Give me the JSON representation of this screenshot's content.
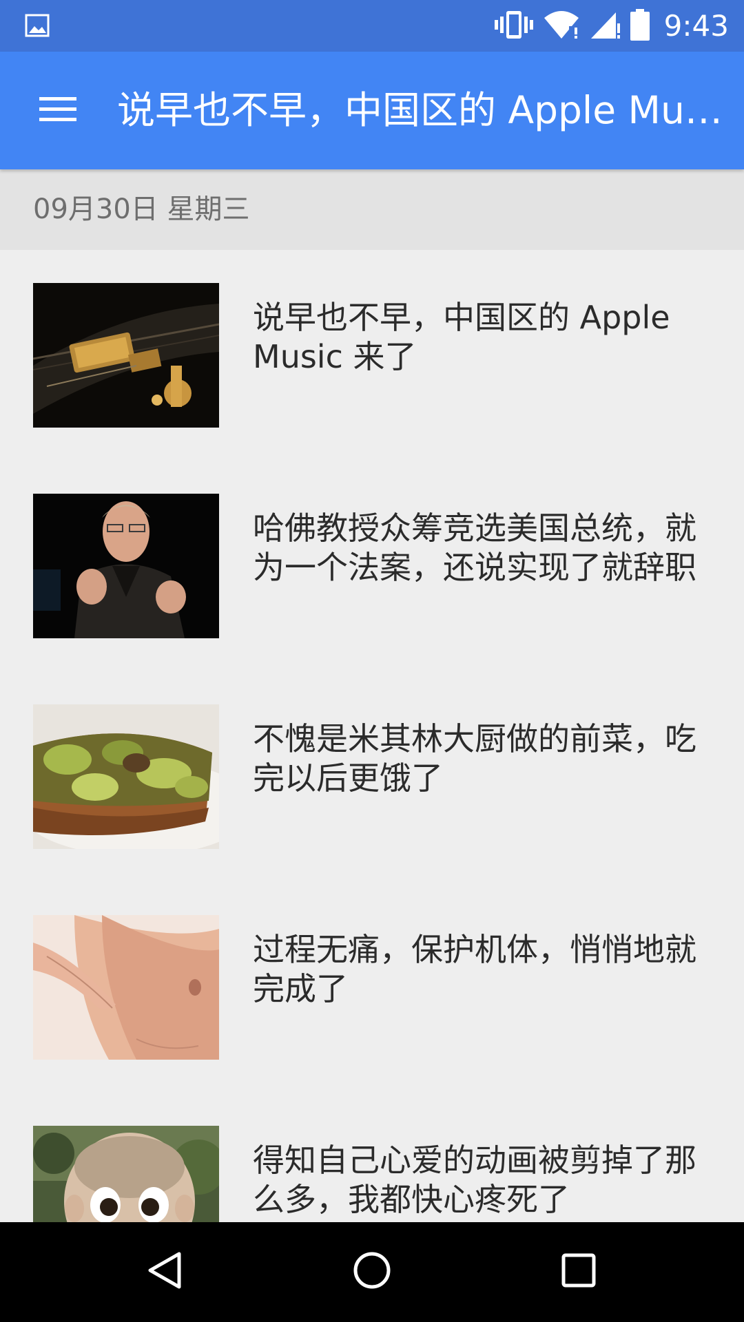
{
  "status_bar": {
    "time": "9:43",
    "icons": [
      "image-notification-icon",
      "vibrate-icon",
      "wifi-icon",
      "cell-signal-icon",
      "battery-icon"
    ]
  },
  "app_bar": {
    "title": "说早也不早，中国区的 Apple Music 来了",
    "menu_icon": "menu-icon",
    "color": "#4285f4"
  },
  "date_header": {
    "text": "09月30日 星期三"
  },
  "articles": [
    {
      "title": "说早也不早，中国区的 Apple Music 来了",
      "thumbnail": "guitar-photo"
    },
    {
      "title": "哈佛教授众筹竞选美国总统，就为一个法案，还说实现了就辞职",
      "thumbnail": "professor-photo"
    },
    {
      "title": "不愧是米其林大厨做的前菜，吃完以后更饿了",
      "thumbnail": "avocado-toast-photo"
    },
    {
      "title": "过程无痛，保护机体，悄悄地就完成了",
      "thumbnail": "abdomen-photo"
    },
    {
      "title": "得知自己心爱的动画被剪掉了那么多，我都快心疼死了",
      "thumbnail": "animated-boy-photo"
    }
  ],
  "nav_bar": {
    "buttons": [
      "back-icon",
      "home-icon",
      "recents-icon"
    ]
  }
}
